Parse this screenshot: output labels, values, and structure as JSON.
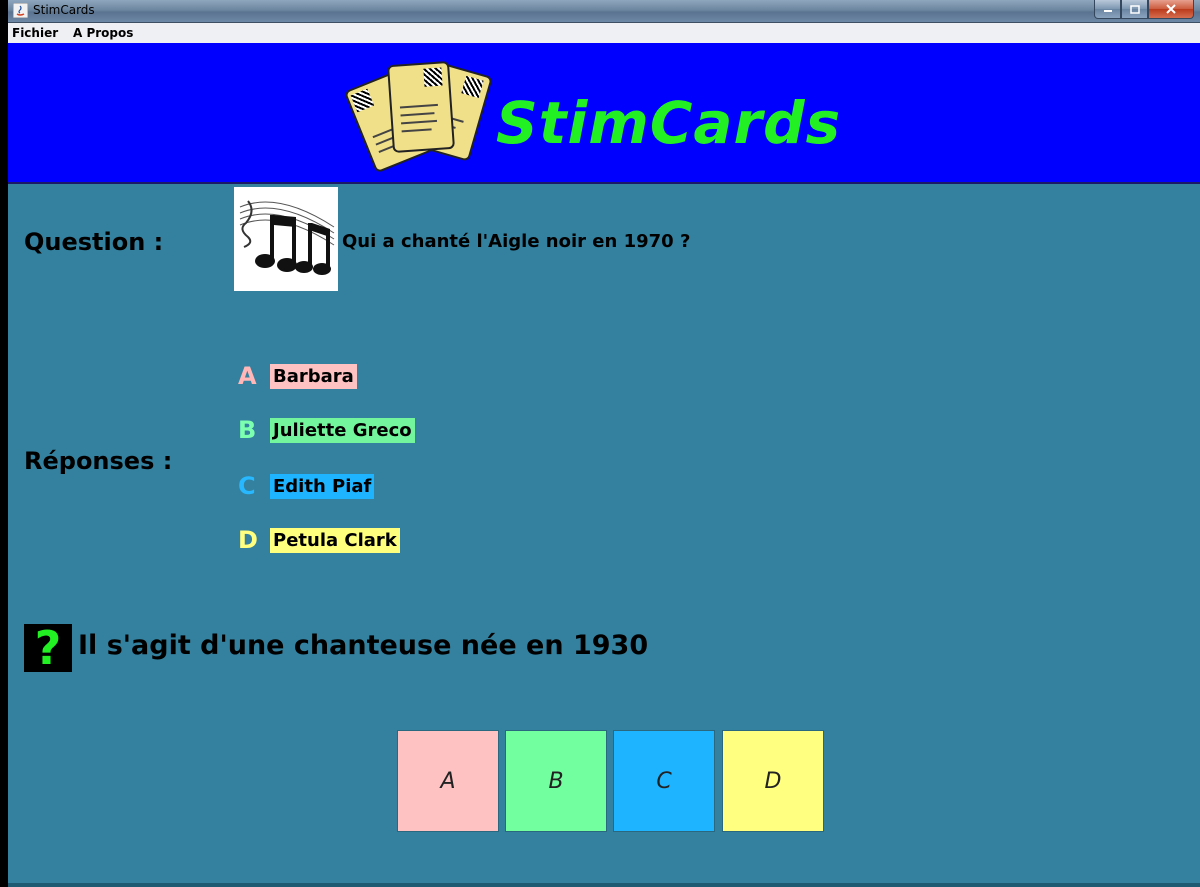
{
  "window": {
    "title": "StimCards"
  },
  "menu": {
    "items": [
      "Fichier",
      "A Propos"
    ]
  },
  "banner": {
    "title": "StimCards"
  },
  "question": {
    "label": "Question :",
    "text": "Qui a chanté l'Aigle noir en 1970 ?",
    "image_icon": "music-notes-icon"
  },
  "answers": {
    "label": "Réponses :",
    "items": [
      {
        "letter": "A",
        "text": "Barbara",
        "letter_color": "#ffb7b7",
        "bg": "#ffc2c2"
      },
      {
        "letter": "B",
        "text": "Juliette Greco",
        "letter_color": "#7dffb0",
        "bg": "#72f59c"
      },
      {
        "letter": "C",
        "text": "Edith Piaf",
        "letter_color": "#27b8ff",
        "bg": "#1eb4ff"
      },
      {
        "letter": "D",
        "text": "Petula Clark",
        "letter_color": "#ffff80",
        "bg": "#ffff7e"
      }
    ]
  },
  "hint": {
    "icon": "question-mark-icon",
    "text": "Il s'agit d'une chanteuse née en 1930"
  },
  "buttons": [
    {
      "label": "A",
      "color": "#ffc2c2"
    },
    {
      "label": "B",
      "color": "#72ffa0"
    },
    {
      "label": "C",
      "color": "#1eb4ff"
    },
    {
      "label": "D",
      "color": "#ffff80"
    }
  ],
  "colors": {
    "background": "#33819f",
    "banner": "#0000ff",
    "banner_title": "#22f022"
  }
}
